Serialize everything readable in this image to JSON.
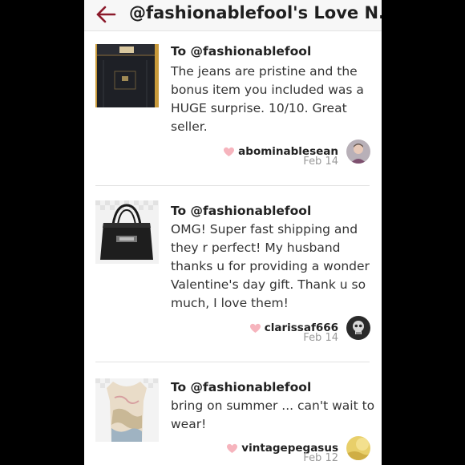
{
  "header": {
    "title": "@fashionablefool's Love N..."
  },
  "reviews": [
    {
      "to": "To @fashionablefool",
      "message": "The jeans are pristine and the bonus item you included was a HUGE surprise. 10/10. Great seller.",
      "username": "abominablesean",
      "date": "Feb 14",
      "thumb_icon": "jeans-photo",
      "avatar_icon": "user-portrait"
    },
    {
      "to": "To @fashionablefool",
      "message": "OMG! Super fast shipping and they r perfect! My husband thanks u for providing a wonder Valentine's day gift. Thank u so much, I love them!",
      "username": "clarissaf666",
      "date": "Feb 14",
      "thumb_icon": "handbag-photo",
      "avatar_icon": "skull-avatar"
    },
    {
      "to": "To @fashionablefool",
      "message": "bring on summer ... can't wait to wear!",
      "username": "vintagepegasus",
      "date": "Feb 12",
      "thumb_icon": "tank-top-photo",
      "avatar_icon": "gold-avatar"
    }
  ],
  "colors": {
    "accent": "#8b1a2b",
    "heart": "#f6b4bd",
    "muted_text": "#9a9a9a",
    "frame": "#000000"
  }
}
